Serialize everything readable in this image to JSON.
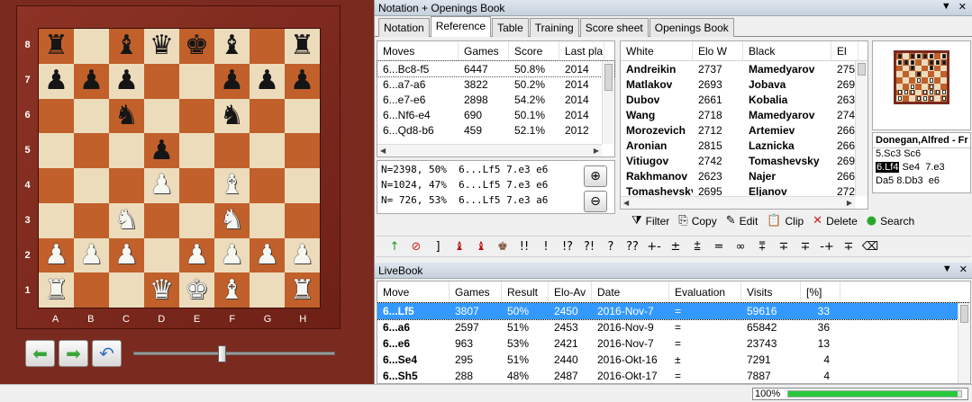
{
  "board": {
    "ranks": [
      "8",
      "7",
      "6",
      "5",
      "4",
      "3",
      "2",
      "1"
    ],
    "files": [
      "A",
      "B",
      "C",
      "D",
      "E",
      "F",
      "G",
      "H"
    ],
    "pieces": [
      {
        "sq": "a8",
        "p": "r"
      },
      {
        "sq": "c8",
        "p": "b"
      },
      {
        "sq": "d8",
        "p": "q"
      },
      {
        "sq": "e8",
        "p": "k"
      },
      {
        "sq": "f8",
        "p": "b"
      },
      {
        "sq": "h8",
        "p": "r"
      },
      {
        "sq": "a7",
        "p": "p"
      },
      {
        "sq": "b7",
        "p": "p"
      },
      {
        "sq": "c7",
        "p": "p"
      },
      {
        "sq": "f7",
        "p": "p"
      },
      {
        "sq": "g7",
        "p": "p"
      },
      {
        "sq": "h7",
        "p": "p"
      },
      {
        "sq": "c6",
        "p": "n"
      },
      {
        "sq": "f6",
        "p": "n"
      },
      {
        "sq": "d5",
        "p": "p"
      },
      {
        "sq": "d4",
        "p": "P"
      },
      {
        "sq": "f4",
        "p": "B"
      },
      {
        "sq": "c3",
        "p": "N"
      },
      {
        "sq": "f3",
        "p": "N"
      },
      {
        "sq": "a2",
        "p": "P"
      },
      {
        "sq": "b2",
        "p": "P"
      },
      {
        "sq": "c2",
        "p": "P"
      },
      {
        "sq": "e2",
        "p": "P"
      },
      {
        "sq": "f2",
        "p": "P"
      },
      {
        "sq": "g2",
        "p": "P"
      },
      {
        "sq": "h2",
        "p": "P"
      },
      {
        "sq": "a1",
        "p": "R"
      },
      {
        "sq": "d1",
        "p": "Q"
      },
      {
        "sq": "e1",
        "p": "K"
      },
      {
        "sq": "f1",
        "p": "B"
      },
      {
        "sq": "h1",
        "p": "R"
      }
    ],
    "controls": {
      "back_icon": "arrow-left-icon",
      "forward_icon": "arrow-right-icon",
      "undo_icon": "undo-icon",
      "slider_level": 0.42
    }
  },
  "notation_panel": {
    "title": "Notation + Openings Book",
    "tabs": [
      "Notation",
      "Reference",
      "Table",
      "Training",
      "Score sheet",
      "Openings Book"
    ],
    "active_tab": "Reference"
  },
  "reference": {
    "headers": [
      "Moves",
      "Games",
      "Score",
      "Last pla"
    ],
    "rows": [
      [
        "6...Bc8-f5",
        "6447",
        "50.8%",
        "2014"
      ],
      [
        "6...a7-a6",
        "3822",
        "50.2%",
        "2014"
      ],
      [
        "6...e7-e6",
        "2898",
        "54.2%",
        "2014"
      ],
      [
        "6...Nf6-e4",
        "690",
        "50.1%",
        "2014"
      ],
      [
        "6...Qd8-b6",
        "459",
        "52.1%",
        "2012"
      ]
    ],
    "notes": [
      "N=2398, 50%  6...Lf5 7.e3 e6",
      "N=1024, 47%  6...Lf5 7.e3 e6",
      "N= 726, 53%  6...Lf5 7.e3 a6"
    ]
  },
  "games": {
    "headers": [
      "White",
      "Elo W",
      "Black",
      "El"
    ],
    "rows": [
      [
        "Andreikin",
        "2737",
        "Mamedyarov",
        "275"
      ],
      [
        "Matlakov",
        "2693",
        "Jobava",
        "269"
      ],
      [
        "Dubov",
        "2661",
        "Kobalia",
        "263"
      ],
      [
        "Wang",
        "2718",
        "Mamedyarov",
        "274"
      ],
      [
        "Morozevich",
        "2712",
        "Artemiev",
        "266"
      ],
      [
        "Aronian",
        "2815",
        "Laznicka",
        "266"
      ],
      [
        "Vitiugov",
        "2742",
        "Tomashevsky",
        "269"
      ],
      [
        "Rakhmanov",
        "2623",
        "Najer",
        "266"
      ],
      [
        "Tomashevsky",
        "2695",
        "Eljanov",
        "272"
      ]
    ],
    "toolbar": [
      {
        "label": "Filter",
        "icon": "filter-icon"
      },
      {
        "label": "Copy",
        "icon": "copy-icon"
      },
      {
        "label": "Edit",
        "icon": "edit-icon"
      },
      {
        "label": "Clip",
        "icon": "clipboard-icon"
      },
      {
        "label": "Delete",
        "icon": "delete-icon"
      },
      {
        "label": "Search",
        "icon": "search-icon"
      }
    ]
  },
  "preview": {
    "title": "Donegan,Alfred - Fr",
    "lines": [
      {
        "a": "5.Sc3",
        "b": "Sc6",
        "hl": false
      },
      {
        "a": "6.Lf4",
        "b": "Se4  7.e3",
        "hl": true
      },
      {
        "a": "Da5",
        "b": "8.Db3  e6",
        "hl": false
      }
    ]
  },
  "annotations": [
    "↑",
    "⊘",
    "]",
    "♝",
    "♝",
    "♚",
    "!!",
    "!",
    "!?",
    "?!",
    "?",
    "??",
    "+-",
    "±",
    "⩲",
    "=",
    "∞",
    "⩱",
    "∓",
    "∓",
    "-+",
    "∓",
    "⌫"
  ],
  "livebook": {
    "title": "LiveBook",
    "headers": [
      "Move",
      "Games",
      "Result",
      "Elo-Av",
      "Date",
      "Evaluation",
      "Visits",
      "[%]"
    ],
    "rows": [
      [
        "6...Lf5",
        "3807",
        "50%",
        "2450",
        "2016-Nov-7",
        "=",
        "59616",
        "33"
      ],
      [
        "6...a6",
        "2597",
        "51%",
        "2453",
        "2016-Nov-9",
        "=",
        "65842",
        "36"
      ],
      [
        "6...e6",
        "963",
        "53%",
        "2421",
        "2016-Nov-7",
        "=",
        "23743",
        "13"
      ],
      [
        "6...Se4",
        "295",
        "51%",
        "2440",
        "2016-Okt-16",
        "±",
        "7291",
        "4"
      ],
      [
        "6...Sh5",
        "288",
        "48%",
        "2487",
        "2016-Okt-17",
        "=",
        "7887",
        "4"
      ]
    ]
  },
  "status": {
    "zoom": "100%",
    "progress": 0.98
  }
}
